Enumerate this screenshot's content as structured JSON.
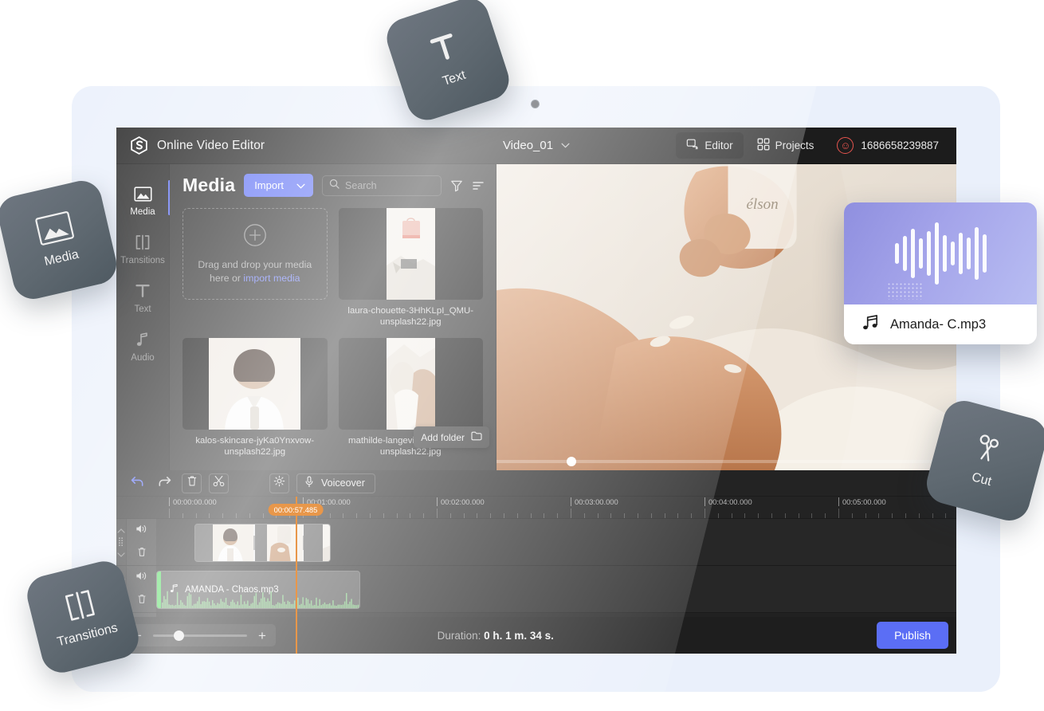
{
  "app": {
    "brand": "Online Video Editor",
    "brand_logo_icon": "hexagon-s-logo-icon",
    "project_name": "Video_01",
    "project_caret_icon": "chevron-down-icon",
    "top_tabs": [
      {
        "label": "Editor",
        "icon": "editor-monitor-icon",
        "active": true
      },
      {
        "label": "Projects",
        "icon": "grid-squares-icon",
        "active": false
      }
    ],
    "user": {
      "id": "1686658239887",
      "avatar_icon": "smiley-face-icon"
    }
  },
  "rail": {
    "items": [
      {
        "label": "Media",
        "icon": "image-icon",
        "active": true
      },
      {
        "label": "Transitions",
        "icon": "transitions-icon",
        "active": false
      },
      {
        "label": "Text",
        "icon": "text-t-icon",
        "active": false
      },
      {
        "label": "Audio",
        "icon": "music-note-icon",
        "active": false
      }
    ]
  },
  "panel": {
    "title": "Media",
    "import_label": "Import",
    "import_caret_icon": "chevron-down-icon",
    "search_placeholder": "Search",
    "search_value": "",
    "search_icon": "search-icon",
    "filter_icon": "filter-funnel-icon",
    "sort_icon": "sort-lines-icon",
    "dropzone": {
      "plus_icon": "plus-circle-icon",
      "text_before": "Drag and drop your media here or ",
      "link_text": "import media"
    },
    "add_folder": {
      "label": "Add folder",
      "icon": "folder-icon"
    },
    "media_items": [
      {
        "name": "laura-chouette-3HhKLpI_QMU-unsplash22.jpg"
      },
      {
        "name": "kalos-skincare-jyKa0Ynxvow-unsplash22.jpg"
      },
      {
        "name": "mathilde-langevin-uKJ1/IIgYZI-unsplash22.jpg"
      }
    ]
  },
  "preview": {
    "scrub_position_pct": 15
  },
  "timeline": {
    "toolbar": [
      {
        "name": "undo",
        "icon": "undo-arrow-icon",
        "active": true
      },
      {
        "name": "redo",
        "icon": "redo-arrow-icon",
        "active": false
      },
      {
        "name": "delete",
        "icon": "trash-icon",
        "active": false
      },
      {
        "name": "cut",
        "icon": "scissors-icon",
        "active": false
      },
      {
        "name": "settings",
        "icon": "gear-icon",
        "active": false
      }
    ],
    "voiceover": {
      "label": "Voiceover",
      "icon": "microphone-icon"
    },
    "ruler_labels": [
      "00:00:00.000",
      "00:01:00.000",
      "00:02:00.000",
      "00:03:00.000",
      "00:04:00.000",
      "00:05:00.000"
    ],
    "playhead_time": "00:00:57.485",
    "tracks": [
      {
        "type": "video",
        "volume_icon": "speaker-icon",
        "delete_icon": "trash-icon",
        "grip_icon": "drag-grip-icon",
        "expand_icon": "chevron-up-icon",
        "collapse_icon": "chevron-down-icon"
      },
      {
        "type": "audio",
        "clip_label": "AMANDA - Chaos.mp3",
        "clip_icon": "music-note-icon",
        "volume_icon": "speaker-icon",
        "delete_icon": "trash-icon",
        "grip_icon": "drag-grip-icon",
        "expand_icon": "chevron-up-icon",
        "collapse_icon": "chevron-down-icon"
      },
      {
        "type": "empty",
        "volume_icon": "speaker-icon",
        "delete_icon": "trash-icon",
        "grip_icon": "drag-grip-icon",
        "expand_icon": "chevron-up-icon",
        "collapse_icon": "chevron-down-icon"
      }
    ]
  },
  "bottom": {
    "zoom_out_label": "−",
    "zoom_in_label": "+",
    "zoom_value_pct": 22,
    "duration_label": "Duration: ",
    "duration_value": "0 h. 1 m. 34 s.",
    "publish_label": "Publish"
  },
  "floating_cards": [
    {
      "label": "Text",
      "icon": "text-t-icon"
    },
    {
      "label": "Media",
      "icon": "image-icon"
    },
    {
      "label": "Transitions",
      "icon": "transitions-icon"
    },
    {
      "label": "Cut",
      "icon": "scissors-icon"
    }
  ],
  "audio_card": {
    "filename": "Amanda- C.mp3",
    "icon": "double-music-note-icon",
    "waveform": [
      26,
      44,
      62,
      38,
      56,
      78,
      46,
      30,
      52,
      40,
      66,
      48
    ],
    "accent": "#9a9ae4"
  },
  "colors": {
    "accent_blue": "#5b6ef5",
    "playhead_orange": "#e8974a",
    "audio_green": "#4ddb5b",
    "avatar_red": "#e8554f",
    "shell_blue": "#eaf0fb"
  }
}
